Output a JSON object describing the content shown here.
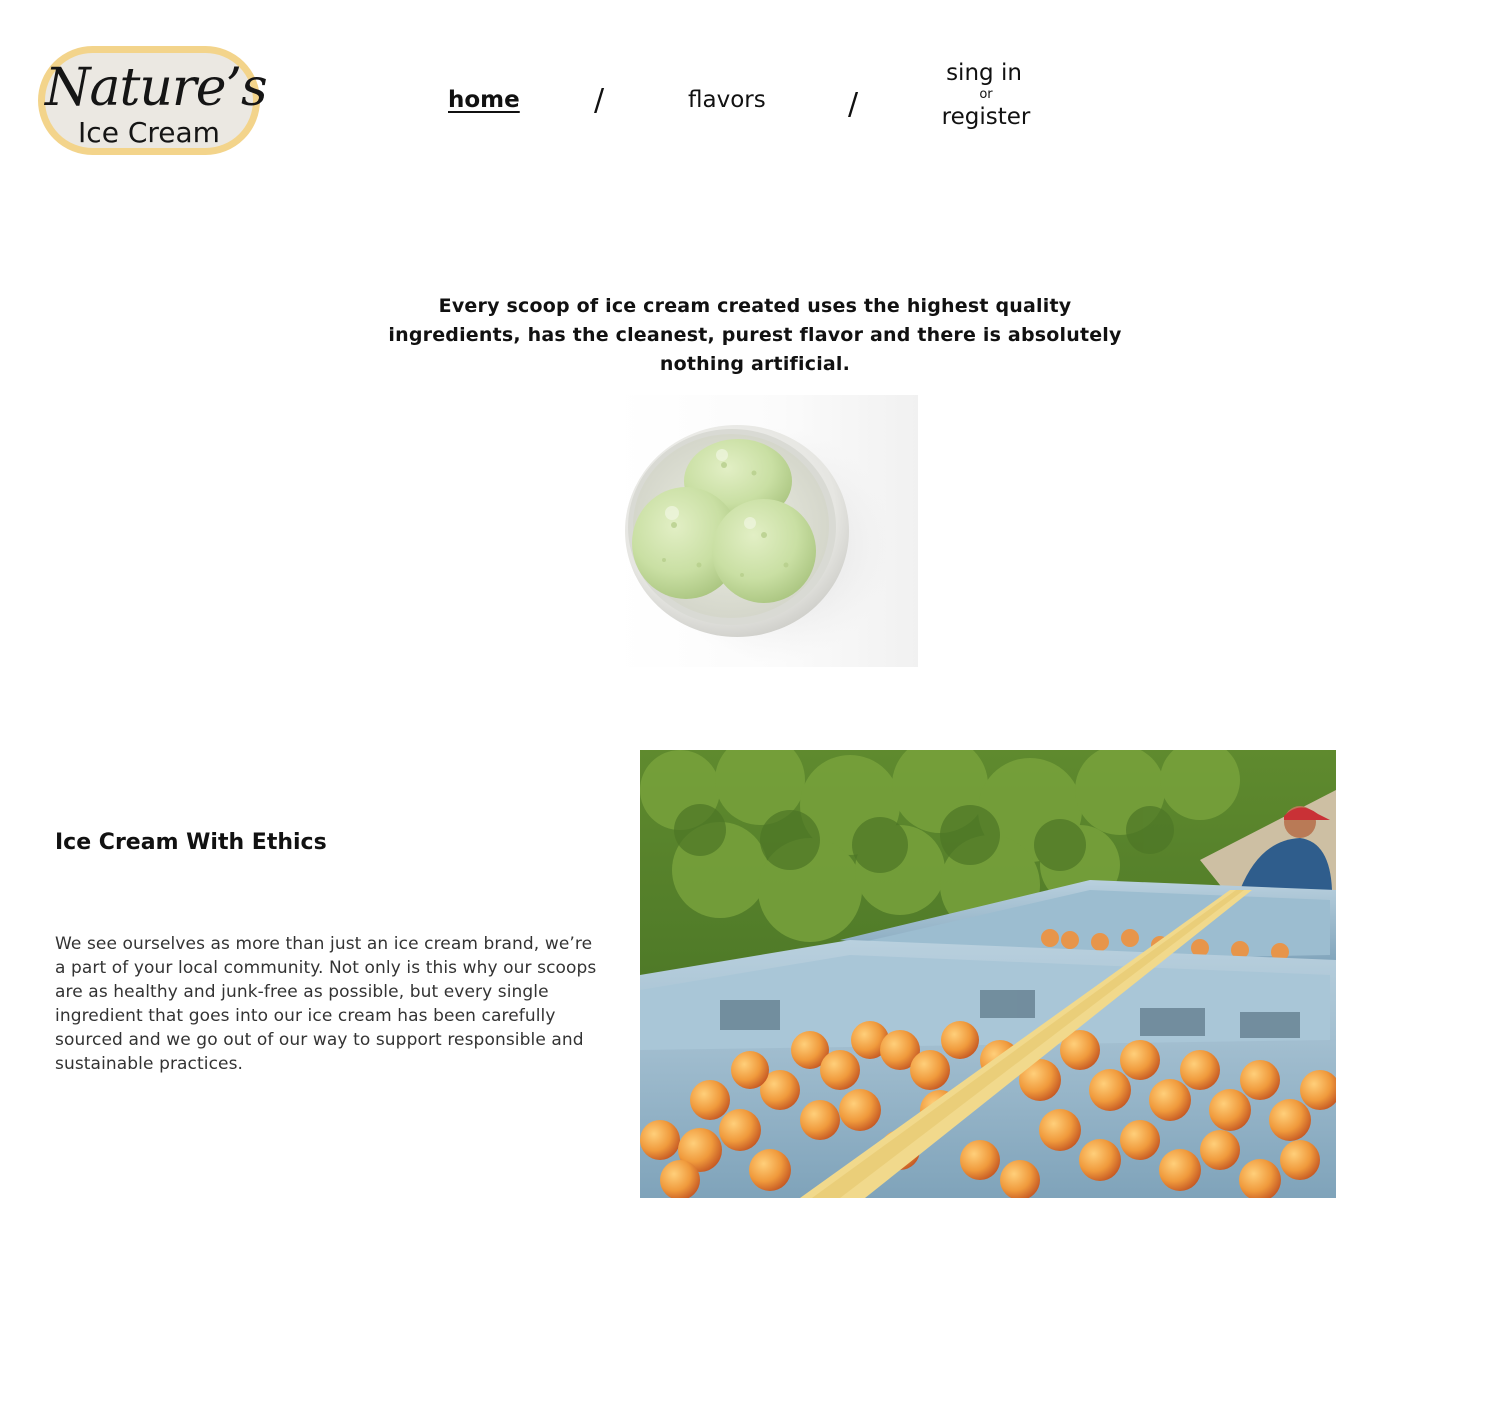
{
  "logo": {
    "script": "Nature’s",
    "subtitle": "Ice Cream",
    "border_color": "#f3d48b",
    "background_color": "#ebe8e2"
  },
  "nav": {
    "home": "home",
    "flavors": "flavors",
    "separator": "/",
    "sign_in": "sing in",
    "or": "or",
    "register": "register",
    "active_item": "home"
  },
  "hero": {
    "tagline": "Every scoop of ice cream created uses the highest quality ingredients, has the cleanest, purest flavor and there is absolutely nothing artificial.",
    "image_subject": "bowl-of-pistachio-ice-cream"
  },
  "ethics": {
    "title": "Ice Cream With Ethics",
    "body": "We see ourselves as more than just an ice cream brand, we’re a part of your local community. Not only is this why our scoops are as healthy and junk-free as possible, but every single ingredient that goes into our ice cream has been carefully sourced and we go out of our way to support responsible and sustainable practices.",
    "image_subject": "apricot-harvest-crates-in-orchard"
  }
}
